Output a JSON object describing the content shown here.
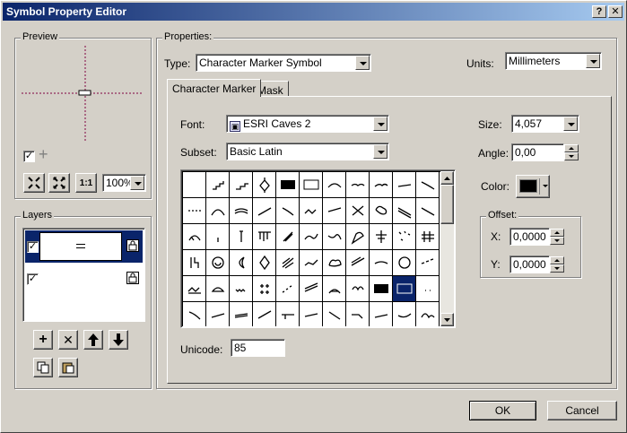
{
  "window": {
    "title": "Symbol Property Editor",
    "help_label": "?",
    "close_label": "x"
  },
  "preview": {
    "label": "Preview",
    "zoom": "100%",
    "fit_label": "1:1"
  },
  "layers": {
    "label": "Layers",
    "items": [
      {
        "checked": true,
        "selected": true
      },
      {
        "checked": true,
        "selected": false
      }
    ]
  },
  "properties": {
    "label": "Properties:",
    "type_label": "Type:",
    "type_value": "Character Marker Symbol",
    "units_label": "Units:",
    "units_value": "Millimeters",
    "tabs": [
      {
        "label": "Character Marker",
        "active": true
      },
      {
        "label": "Mask",
        "active": false
      }
    ],
    "font_label": "Font:",
    "font_value": "ESRI Caves 2",
    "subset_label": "Subset:",
    "subset_value": "Basic Latin",
    "size_label": "Size:",
    "size_value": "4,057",
    "angle_label": "Angle:",
    "angle_value": "0,00",
    "color_label": "Color:",
    "color_value": "#000000",
    "offset_label": "Offset:",
    "x_label": "X:",
    "x_value": "0,0000",
    "y_label": "Y:",
    "y_value": "0,0000",
    "unicode_label": "Unicode:",
    "unicode_value": "85"
  },
  "buttons": {
    "ok": "OK",
    "cancel": "Cancel"
  },
  "colors": {
    "title_start": "#0a246a",
    "title_end": "#a6caf0",
    "selection": "#0a246a",
    "preview_crosshair": "#800040"
  }
}
